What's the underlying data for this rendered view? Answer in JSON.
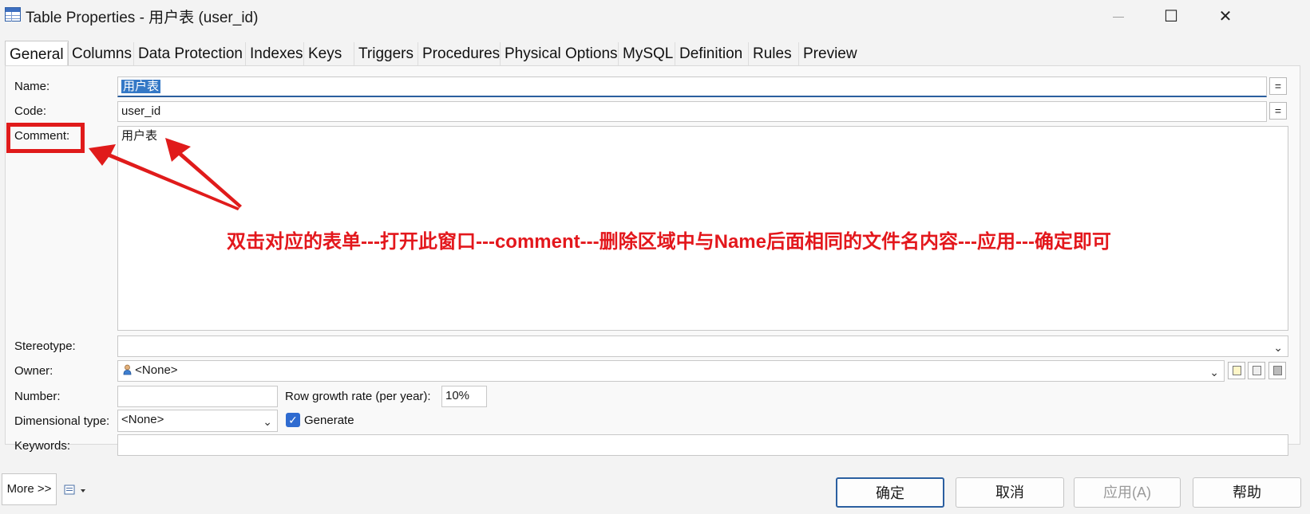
{
  "window": {
    "title": "Table Properties - 用户表 (user_id)",
    "minimize_glyph": "—",
    "maximize_glyph": "☐",
    "close_glyph": "✕"
  },
  "tabs": [
    {
      "label": "General",
      "active": true
    },
    {
      "label": "Columns"
    },
    {
      "label": "Data Protection"
    },
    {
      "label": "Indexes"
    },
    {
      "label": "Keys"
    },
    {
      "label": "Triggers"
    },
    {
      "label": "Procedures"
    },
    {
      "label": "Physical Options"
    },
    {
      "label": "MySQL"
    },
    {
      "label": "Definition"
    },
    {
      "label": "Rules"
    },
    {
      "label": "Preview"
    }
  ],
  "form": {
    "name_label": "Name:",
    "name_value": "用户表",
    "code_label": "Code:",
    "code_value": "user_id",
    "comment_label": "Comment:",
    "comment_value": "用户表",
    "stereotype_label": "Stereotype:",
    "stereotype_value": "",
    "owner_label": "Owner:",
    "owner_value": "<None>",
    "number_label": "Number:",
    "number_value": "",
    "row_growth_label": "Row growth rate (per year):",
    "row_growth_value": "10%",
    "dimensional_label": "Dimensional type:",
    "dimensional_value": "<None>",
    "generate_label": "Generate",
    "generate_checked": true,
    "keywords_label": "Keywords:",
    "keywords_value": "",
    "equals_glyph": "="
  },
  "annotation": {
    "text": "双击对应的表单---打开此窗口---comment---删除区域中与Name后面相同的文件名内容---应用---确定即可",
    "color": "#e3171c"
  },
  "bottom": {
    "more_label": "More >>",
    "ok_label": "确定",
    "cancel_label": "取消",
    "apply_label": "应用(A)",
    "help_label": "帮助"
  },
  "icons": [
    "table-icon",
    "owner-person-icon",
    "chevron-down-icon",
    "new-object-icon",
    "properties-icon",
    "browse-icon",
    "print-icon"
  ]
}
